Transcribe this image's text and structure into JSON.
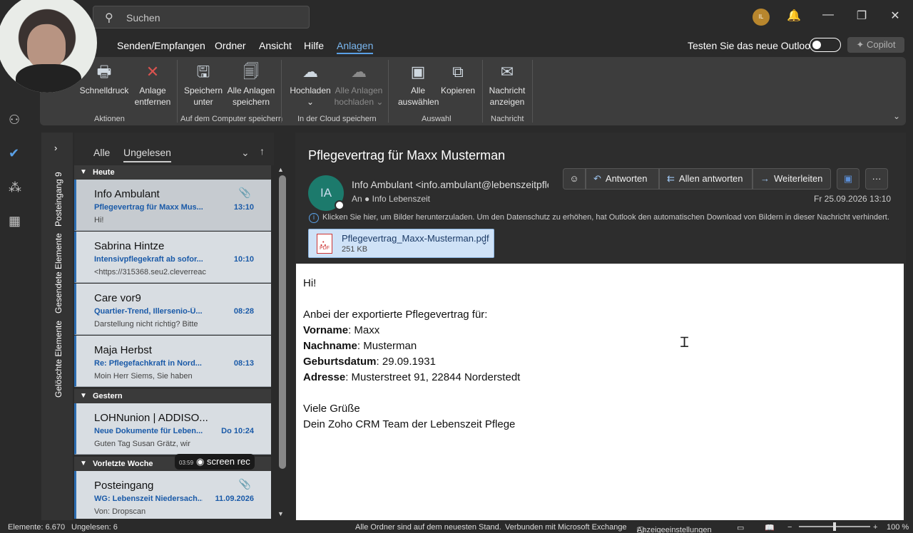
{
  "titlebar": {
    "search_placeholder": "Suchen",
    "profile_initials": "IL",
    "bell": "🔔",
    "minimize": "—",
    "restore": "❐",
    "close": "✕"
  },
  "menu": {
    "items": [
      "Senden/Empfangen",
      "Ordner",
      "Ansicht",
      "Hilfe",
      "Anlagen"
    ],
    "try_new_outlook": "Testen Sie das neue Outlook",
    "copilot": "Copilot"
  },
  "ribbon": {
    "quick_print": "Schnelldruck",
    "remove_attachment": [
      "Anlage",
      "entfernen"
    ],
    "group_actions": "Aktionen",
    "save_as": [
      "Speichern",
      "unter"
    ],
    "save_all": [
      "Alle Anlagen",
      "speichern"
    ],
    "group_save_computer": "Auf dem Computer speichern",
    "upload": "Hochladen",
    "upload_all": [
      "Alle Anlagen",
      "hochladen"
    ],
    "group_save_cloud": "In der Cloud speichern",
    "select_all": [
      "Alle",
      "auswählen"
    ],
    "copy": "Kopieren",
    "group_selection": "Auswahl",
    "show_message": [
      "Nachricht",
      "anzeigen"
    ],
    "group_message": "Nachricht"
  },
  "folders": {
    "inbox": "Posteingang 9",
    "sent": "Gesendete Elemente",
    "deleted": "Gelöschte Elemente"
  },
  "list": {
    "tab_all": "Alle",
    "tab_unread": "Ungelesen",
    "groups": {
      "today": "Heute",
      "yesterday": "Gestern",
      "week_before_last": "Vorletzte Woche"
    },
    "items": [
      {
        "from": "Info Ambulant",
        "subject": "Pflegevertrag für Maxx Mus...",
        "time": "13:10",
        "preview": "Hi!"
      },
      {
        "from": "Sabrina Hintze",
        "subject": "Intensivpflegekraft ab sofor...",
        "time": "10:10",
        "preview": "<https://315368.seu2.cleverreac"
      },
      {
        "from": "Care vor9",
        "subject": "Quartier-Trend, Illersenio-Ü...",
        "time": "08:28",
        "preview": "Darstellung nicht richtig? Bitte"
      },
      {
        "from": "Maja Herbst",
        "subject": "Re: Pflegefachkraft in Nord...",
        "time": "08:13",
        "preview": "Moin Herr Siems,  Sie haben"
      },
      {
        "from": "LOHNunion | ADDISO...",
        "subject": "Neue Dokumente für Leben...",
        "time": "Do 10:24",
        "preview": "Guten Tag Susan Grätz,  wir"
      },
      {
        "from": "Posteingang",
        "subject": "WG: Lebenszeit Niedersach...",
        "time": "11.09.2026",
        "preview": "Von: Dropscan"
      }
    ],
    "screenrec_time": "03:59",
    "screenrec_label": "screen rec"
  },
  "message": {
    "subject": "Pflegevertrag für Maxx Musterman",
    "avatar_initials": "IA",
    "sender": "Info Ambulant <info.ambulant@lebenszeitpflege",
    "to_label": "An",
    "to_name": "Info Lebenszeit",
    "date": "Fr 25.09.2026 13:10",
    "reply": "Antworten",
    "reply_all": "Allen antworten",
    "forward": "Weiterleiten",
    "info_bar": "Klicken Sie hier, um Bilder herunterzuladen. Um den Datenschutz zu erhöhen, hat Outlook den automatischen Download von Bildern in dieser Nachricht verhindert.",
    "attachment_name": "Pflegevertrag_Maxx-Musterman.pdf",
    "attachment_size": "251 KB",
    "attachment_type": "PDF",
    "body": {
      "greeting": "Hi!",
      "intro": "Anbei der exportierte Pflegevertrag für:",
      "firstname_label": "Vorname",
      "firstname": ": Maxx",
      "lastname_label": "Nachname",
      "lastname": ": Musterman",
      "birth_label": "Geburtsdatum",
      "birth": ": 29.09.1931",
      "address_label": "Adresse",
      "address": ": Musterstreet 91, 22844 Norderstedt",
      "closing": "Viele Grüße",
      "signature": "Dein Zoho CRM Team der Lebenszeit Pflege"
    }
  },
  "status": {
    "items": "Elemente: 6.670",
    "unread": "Ungelesen: 6",
    "uptodate": "Alle Ordner sind auf dem neuesten Stand.",
    "connected": "Verbunden mit Microsoft Exchange",
    "display_settings": "Anzeigeeinstellungen",
    "zoom": "100 %",
    "zoom_level": 0.5
  }
}
